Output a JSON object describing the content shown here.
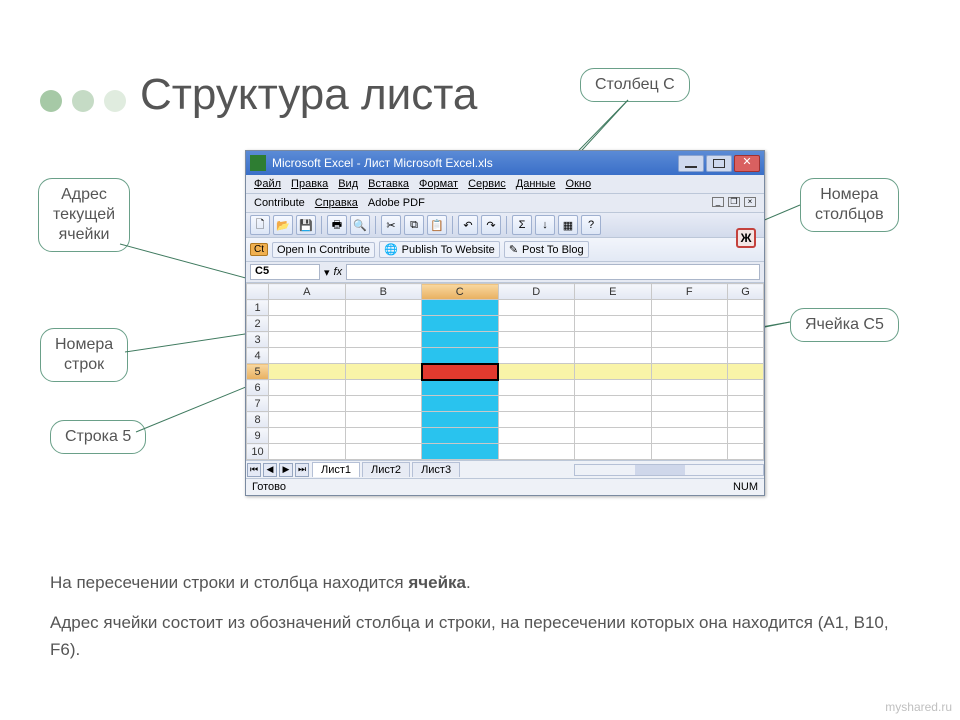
{
  "title": "Структура листа",
  "callouts": {
    "columnC": "Столбец С",
    "currentCellAddress": "Адрес\nтекущей\nячейки",
    "columnNumbers": "Номера\nстолбцов",
    "rowNumbers": "Номера\nстрок",
    "cellC5": "Ячейка С5",
    "row5": "Строка 5"
  },
  "excel": {
    "windowTitle": "Microsoft Excel - Лист Microsoft Excel.xls",
    "menu1": [
      "Файл",
      "Правка",
      "Вид",
      "Вставка",
      "Формат",
      "Сервис",
      "Данные",
      "Окно"
    ],
    "menu2": [
      "Contribute",
      "Справка",
      "Adobe PDF"
    ],
    "boldLabel": "Ж",
    "contrib": {
      "ct": "Ct",
      "open": "Open In Contribute",
      "publish": "Publish To Website",
      "post": "Post To Blog"
    },
    "namebox": "C5",
    "fxLabel": "fx",
    "columns": [
      "A",
      "B",
      "C",
      "D",
      "E",
      "F",
      "G"
    ],
    "rows": [
      "1",
      "2",
      "3",
      "4",
      "5",
      "6",
      "7",
      "8",
      "9",
      "10"
    ],
    "tabs": [
      "Лист1",
      "Лист2",
      "Лист3"
    ],
    "status": {
      "ready": "Готово",
      "num": "NUM"
    }
  },
  "description": {
    "p1a": "На пересечении строки и столбца находится ",
    "p1b": "ячейка",
    "p1c": ".",
    "p2": "Адрес ячейки состоит из обозначений столбца и строки, на пересечении которых она находится (A1, B10, F6)."
  },
  "watermark": "myshared.ru"
}
